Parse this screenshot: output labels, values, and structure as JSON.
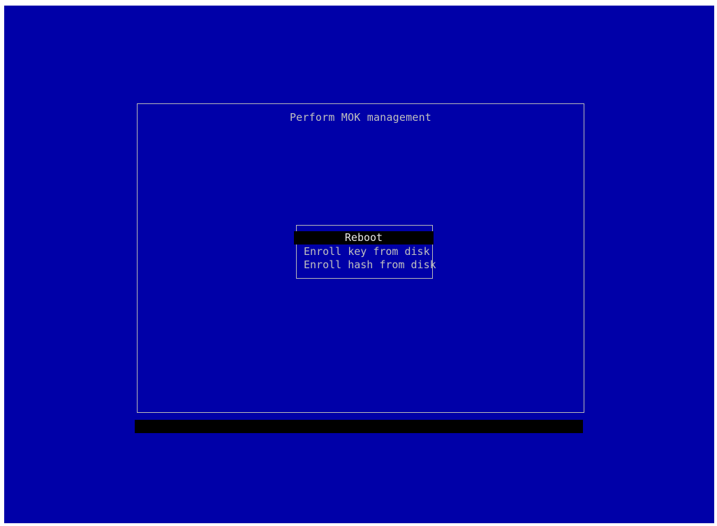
{
  "screen": {
    "background_color": "#0000a8",
    "foreground_color": "#c0c0c0",
    "highlight_color": "#000000"
  },
  "dialog": {
    "title": "Perform MOK management"
  },
  "menu": {
    "selected_index": 0,
    "items": [
      {
        "label": "Reboot"
      },
      {
        "label": "Enroll key from disk"
      },
      {
        "label": "Enroll hash from disk"
      }
    ]
  },
  "status_bar": {
    "text": ""
  }
}
